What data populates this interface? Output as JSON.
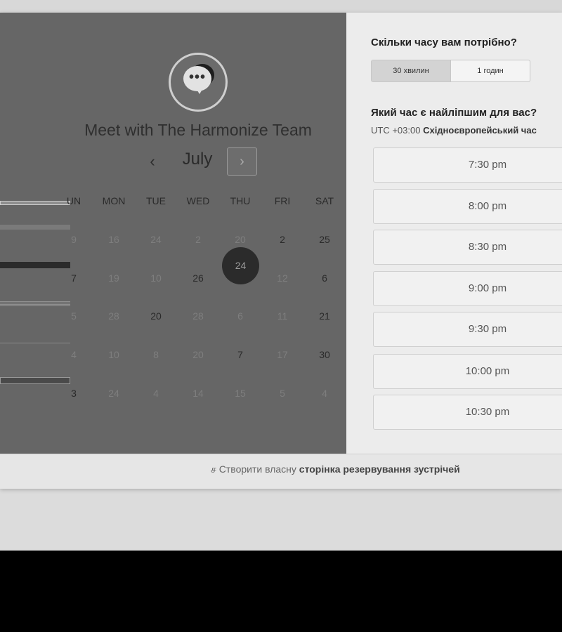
{
  "left_panel": {
    "team_title": "Meet with The Harmonize Team",
    "logo_icon": "speech-bubble-icon",
    "logo_dots": "•••",
    "calendar": {
      "prev_label": "‹",
      "month": "July",
      "next_label": "›",
      "weekdays": [
        "UN",
        "MON",
        "TUE",
        "WED",
        "THU",
        "FRI",
        "SAT"
      ],
      "weeks": [
        [
          {
            "d": "9",
            "avail": false
          },
          {
            "d": "16",
            "avail": false
          },
          {
            "d": "24",
            "avail": false
          },
          {
            "d": "2",
            "avail": false
          },
          {
            "d": "20",
            "avail": false
          },
          {
            "d": "2",
            "avail": true
          },
          {
            "d": "25",
            "avail": true
          }
        ],
        [
          {
            "d": "7",
            "avail": true
          },
          {
            "d": "19",
            "avail": false
          },
          {
            "d": "10",
            "avail": false
          },
          {
            "d": "26",
            "avail": true
          },
          {
            "d": "24",
            "avail": true,
            "selected": true
          },
          {
            "d": "12",
            "avail": false
          },
          {
            "d": "6",
            "avail": true
          }
        ],
        [
          {
            "d": "5",
            "avail": false
          },
          {
            "d": "28",
            "avail": false
          },
          {
            "d": "20",
            "avail": true
          },
          {
            "d": "28",
            "avail": false
          },
          {
            "d": "6",
            "avail": false
          },
          {
            "d": "11",
            "avail": false
          },
          {
            "d": "21",
            "avail": true
          }
        ],
        [
          {
            "d": "4",
            "avail": false
          },
          {
            "d": "10",
            "avail": false
          },
          {
            "d": "8",
            "avail": false
          },
          {
            "d": "20",
            "avail": false
          },
          {
            "d": "7",
            "avail": true
          },
          {
            "d": "17",
            "avail": false
          },
          {
            "d": "30",
            "avail": true
          }
        ],
        [
          {
            "d": "3",
            "avail": true
          },
          {
            "d": "24",
            "avail": false
          },
          {
            "d": "4",
            "avail": false
          },
          {
            "d": "14",
            "avail": false
          },
          {
            "d": "15",
            "avail": false
          },
          {
            "d": "5",
            "avail": false
          },
          {
            "d": "4",
            "avail": false
          }
        ]
      ]
    }
  },
  "right_panel": {
    "duration_question": "Скільки часу вам потрібно?",
    "durations": [
      "30 хвилин",
      "1 годин"
    ],
    "selected_duration": "30 хвилин",
    "time_question": "Який час є найліпшим для вас?",
    "timezone_offset": "UTC +03:00",
    "timezone_name": "Східноєвропейський час",
    "slots": [
      "7:30 pm",
      "8:00 pm",
      "8:30 pm",
      "9:00 pm",
      "9:30 pm",
      "10:00 pm",
      "10:30 pm"
    ]
  },
  "footer": {
    "icon": "hubspot-sprocket-icon",
    "icon_glyph": "ச",
    "prefix": "Створити власну",
    "link": "сторінка резервування зустрічей"
  },
  "colors": {
    "overlay_gray": "#666666",
    "selected_day": "#2b2b2b",
    "panel_bg": "#ececec"
  }
}
